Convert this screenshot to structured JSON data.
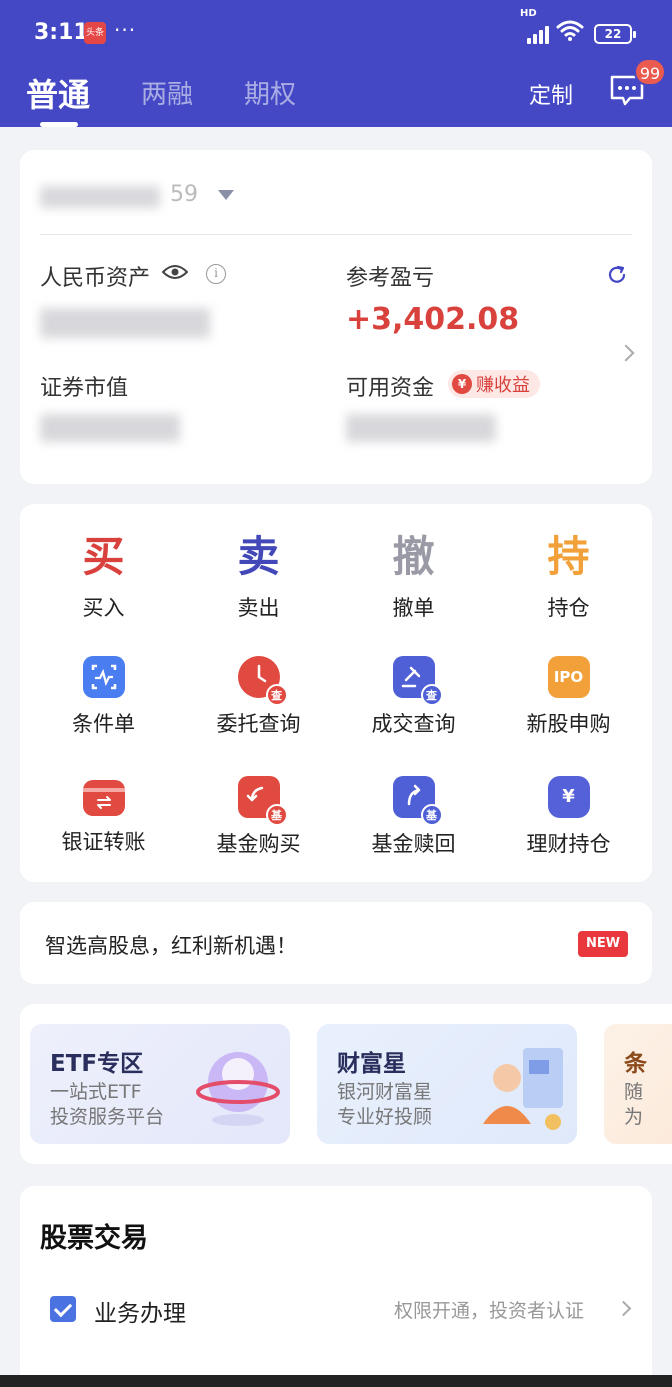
{
  "status": {
    "time": "3:11",
    "app_badge": "头条",
    "dots": "···",
    "signal_label": "HD",
    "battery": "22"
  },
  "header": {
    "tabs": [
      {
        "label": "普通"
      },
      {
        "label": "两融"
      },
      {
        "label": "期权"
      }
    ],
    "customize_label": "定制",
    "message_count": "99"
  },
  "account": {
    "number_suffix": "59"
  },
  "assets": {
    "rmb_label": "人民币资产",
    "info_glyph": "i",
    "profit_label": "参考盈亏",
    "profit_value": "+3,402.08",
    "securities_label": "证券市值",
    "available_label": "可用资金",
    "earn_label": "赚收益",
    "yen": "¥"
  },
  "trade": {
    "primary": [
      {
        "char": "买",
        "label": "买入",
        "color": "#d9413c"
      },
      {
        "char": "卖",
        "label": "卖出",
        "color": "#4248b8"
      },
      {
        "char": "撤",
        "label": "撤单",
        "color": "#9a9aa6"
      },
      {
        "char": "持",
        "label": "持仓",
        "color": "#f2a13a"
      }
    ],
    "secondary": [
      {
        "label": "条件单",
        "icon": "condition-order-icon"
      },
      {
        "label": "委托查询",
        "icon": "entrust-query-icon",
        "sub": "查"
      },
      {
        "label": "成交查询",
        "icon": "deal-query-icon",
        "sub": "查"
      },
      {
        "label": "新股申购",
        "icon": "ipo-icon",
        "badge": "IPO"
      },
      {
        "label": "银证转账",
        "icon": "bank-transfer-icon"
      },
      {
        "label": "基金购买",
        "icon": "fund-buy-icon",
        "sub": "基"
      },
      {
        "label": "基金赎回",
        "icon": "fund-redeem-icon",
        "sub": "基"
      },
      {
        "label": "理财持仓",
        "icon": "wealth-holding-icon",
        "badge": "¥"
      }
    ]
  },
  "promo": {
    "text": "智选高股息，红利新机遇！",
    "badge": "NEW"
  },
  "features": [
    {
      "title": "ETF专区",
      "desc": "一站式ETF\n投资服务平台"
    },
    {
      "title": "财富星",
      "desc": "银河财富星\n专业好投顾"
    },
    {
      "title": "条",
      "desc": "随\n为"
    }
  ],
  "stock_section": {
    "title": "股票交易",
    "business_label": "业务办理",
    "business_hint": "权限开通，投资者认证"
  },
  "colors": {
    "brand": "#4448c4",
    "profit": "#d9413c"
  }
}
